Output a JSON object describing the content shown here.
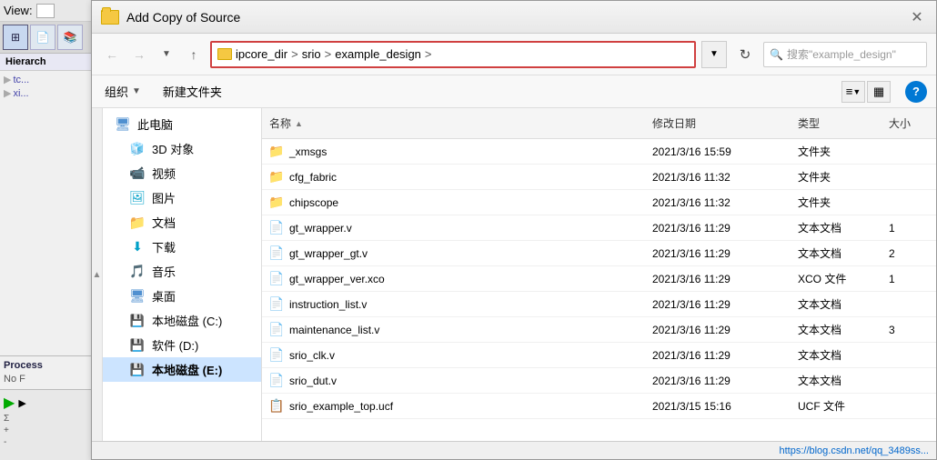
{
  "dialog": {
    "title": "Add Copy of Source",
    "close_label": "✕"
  },
  "addressBar": {
    "path": {
      "part1": "ipcore_dir",
      "sep1": ">",
      "part2": "srio",
      "sep2": ">",
      "part3": "example_design",
      "sep3": ">"
    },
    "search_placeholder": "搜索\"example_design\""
  },
  "toolbar": {
    "organize_label": "组织",
    "new_folder_label": "新建文件夹",
    "view_icon": "≡",
    "tiles_icon": "▦",
    "help_label": "?"
  },
  "nav_items": [
    {
      "id": "pc",
      "label": "此电脑",
      "icon": "🖥",
      "indent": 0
    },
    {
      "id": "3d",
      "label": "3D 对象",
      "icon": "🧊",
      "indent": 1
    },
    {
      "id": "video",
      "label": "视频",
      "icon": "📹",
      "indent": 1
    },
    {
      "id": "photo",
      "label": "图片",
      "icon": "🖼",
      "indent": 1
    },
    {
      "id": "doc",
      "label": "文档",
      "icon": "📁",
      "indent": 1
    },
    {
      "id": "download",
      "label": "下载",
      "icon": "⬇",
      "indent": 1
    },
    {
      "id": "music",
      "label": "音乐",
      "icon": "🎵",
      "indent": 1
    },
    {
      "id": "desktop",
      "label": "桌面",
      "icon": "🖥",
      "indent": 1
    },
    {
      "id": "disk-c",
      "label": "本地磁盘 (C:)",
      "icon": "💾",
      "indent": 1
    },
    {
      "id": "disk-d",
      "label": "软件 (D:)",
      "icon": "💾",
      "indent": 1
    },
    {
      "id": "disk-e",
      "label": "本地磁盘 (E:)",
      "icon": "💾",
      "indent": 1,
      "selected": true
    }
  ],
  "file_list": {
    "headers": [
      {
        "id": "name",
        "label": "名称",
        "sort": "▲"
      },
      {
        "id": "date",
        "label": "修改日期"
      },
      {
        "id": "type",
        "label": "类型"
      },
      {
        "id": "size",
        "label": "大小"
      }
    ],
    "files": [
      {
        "name": "_xmsgs",
        "date": "2021/3/16 15:59",
        "type": "文件夹",
        "size": "",
        "icon": "folder"
      },
      {
        "name": "cfg_fabric",
        "date": "2021/3/16 11:32",
        "type": "文件夹",
        "size": "",
        "icon": "folder"
      },
      {
        "name": "chipscope",
        "date": "2021/3/16 11:32",
        "type": "文件夹",
        "size": "",
        "icon": "folder"
      },
      {
        "name": "gt_wrapper.v",
        "date": "2021/3/16 11:29",
        "type": "文本文档",
        "size": "1",
        "icon": "doc"
      },
      {
        "name": "gt_wrapper_gt.v",
        "date": "2021/3/16 11:29",
        "type": "文本文档",
        "size": "2",
        "icon": "doc"
      },
      {
        "name": "gt_wrapper_ver.xco",
        "date": "2021/3/16 11:29",
        "type": "XCO 文件",
        "size": "1",
        "icon": "xco"
      },
      {
        "name": "instruction_list.v",
        "date": "2021/3/16 11:29",
        "type": "文本文档",
        "size": "",
        "icon": "doc"
      },
      {
        "name": "maintenance_list.v",
        "date": "2021/3/16 11:29",
        "type": "文本文档",
        "size": "3",
        "icon": "doc"
      },
      {
        "name": "srio_clk.v",
        "date": "2021/3/16 11:29",
        "type": "文本文档",
        "size": "",
        "icon": "doc"
      },
      {
        "name": "srio_dut.v",
        "date": "2021/3/16 11:29",
        "type": "文本文档",
        "size": "",
        "icon": "doc"
      },
      {
        "name": "srio_example_top.ucf",
        "date": "2021/3/15 15:16",
        "type": "UCF 文件",
        "size": "",
        "icon": "ucf"
      }
    ]
  },
  "status": {
    "url": "https://blog.csdn.net/qq_3489ss..."
  },
  "ide": {
    "view_label": "View:",
    "hierarchy_label": "Hierarch",
    "process_label": "Process",
    "no_label": "No F"
  }
}
